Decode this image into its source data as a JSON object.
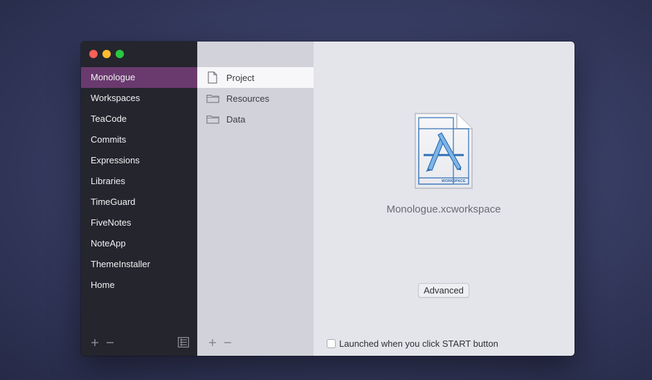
{
  "sidebar": {
    "items": [
      {
        "label": "Monologue",
        "active": true
      },
      {
        "label": "Workspaces"
      },
      {
        "label": "TeaCode"
      },
      {
        "label": "Commits"
      },
      {
        "label": "Expressions"
      },
      {
        "label": "Libraries"
      },
      {
        "label": "TimeGuard"
      },
      {
        "label": "FiveNotes"
      },
      {
        "label": "NoteApp"
      },
      {
        "label": "ThemeInstaller"
      },
      {
        "label": "Home"
      }
    ],
    "add_icon": "plus-icon",
    "remove_icon": "minus-icon",
    "list_icon": "list-icon"
  },
  "middle": {
    "items": [
      {
        "label": "Project",
        "icon": "document-icon",
        "active": true
      },
      {
        "label": "Resources",
        "icon": "folder-icon"
      },
      {
        "label": "Data",
        "icon": "folder-icon"
      }
    ]
  },
  "detail": {
    "file_name": "Monologue.xcworkspace",
    "file_badge": "WORKSPACE",
    "advanced_label": "Advanced",
    "launch_label": "Launched when you click START button",
    "launch_checked": false
  },
  "colors": {
    "accent": "#6a3a6e",
    "sidebar_bg": "#25252d",
    "middle_bg": "#d2d3da",
    "detail_bg": "#e4e5eb"
  }
}
